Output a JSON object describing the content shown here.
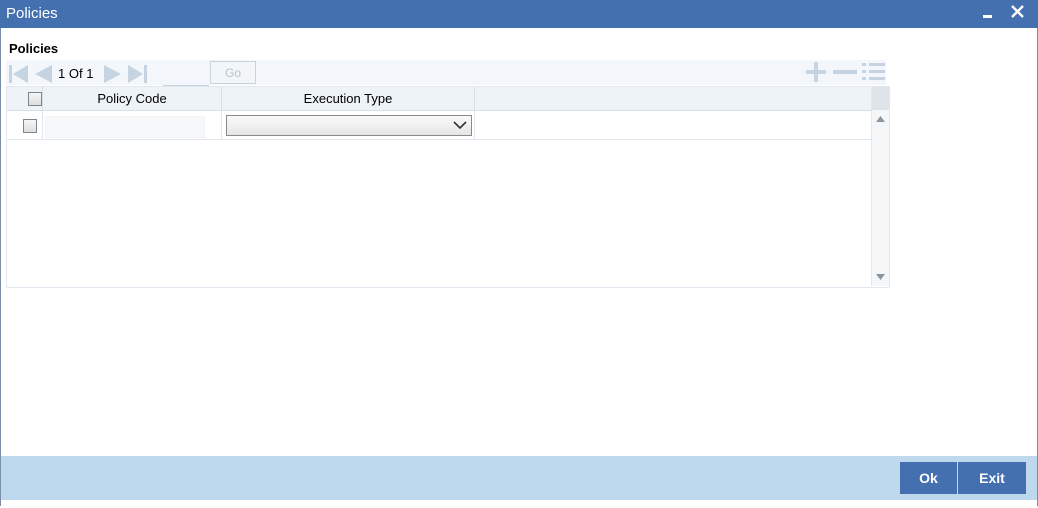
{
  "window": {
    "title": "Policies",
    "minimize_glyph": "▁",
    "close_glyph": "✕"
  },
  "section": {
    "title": "Policies"
  },
  "pager": {
    "current": "1",
    "of_label": "Of",
    "total": "1",
    "go_label": "Go",
    "goto_value": ""
  },
  "icons": {
    "first": "first-page-icon",
    "prev": "previous-page-icon",
    "next": "next-page-icon",
    "last": "last-page-icon",
    "add": "plus-icon",
    "remove": "minus-icon",
    "view": "list-view-icon"
  },
  "grid": {
    "columns": [
      "Policy Code",
      "Execution Type"
    ],
    "rows": [
      {
        "policy_code": "",
        "execution_type": ""
      }
    ]
  },
  "footer": {
    "ok_label": "Ok",
    "exit_label": "Exit"
  },
  "colors": {
    "title_bar": "#4470b0",
    "footer_bar": "#bed9ee",
    "button": "#4470b0",
    "nav_icons": "#c6d4e2"
  }
}
